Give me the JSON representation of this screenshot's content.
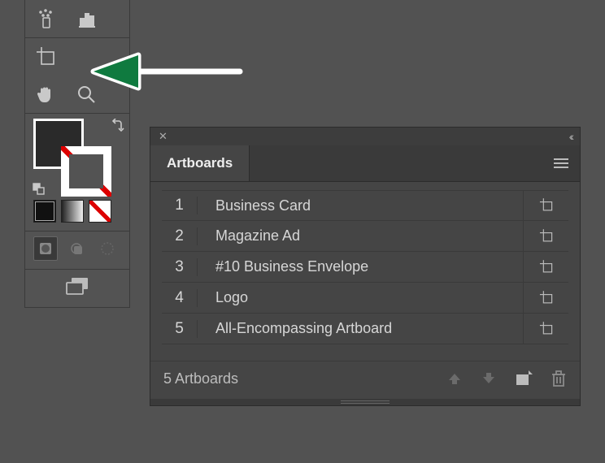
{
  "panel": {
    "tab_label": "Artboards",
    "footer_label": "5 Artboards",
    "rows": [
      {
        "num": "1",
        "name": "Business Card"
      },
      {
        "num": "2",
        "name": "Magazine Ad"
      },
      {
        "num": "3",
        "name": "#10 Business Envelope"
      },
      {
        "num": "4",
        "name": "Logo"
      },
      {
        "num": "5",
        "name": "All-Encompassing Artboard"
      }
    ]
  },
  "icons": {
    "close": "✕",
    "collapse": "‹‹"
  }
}
